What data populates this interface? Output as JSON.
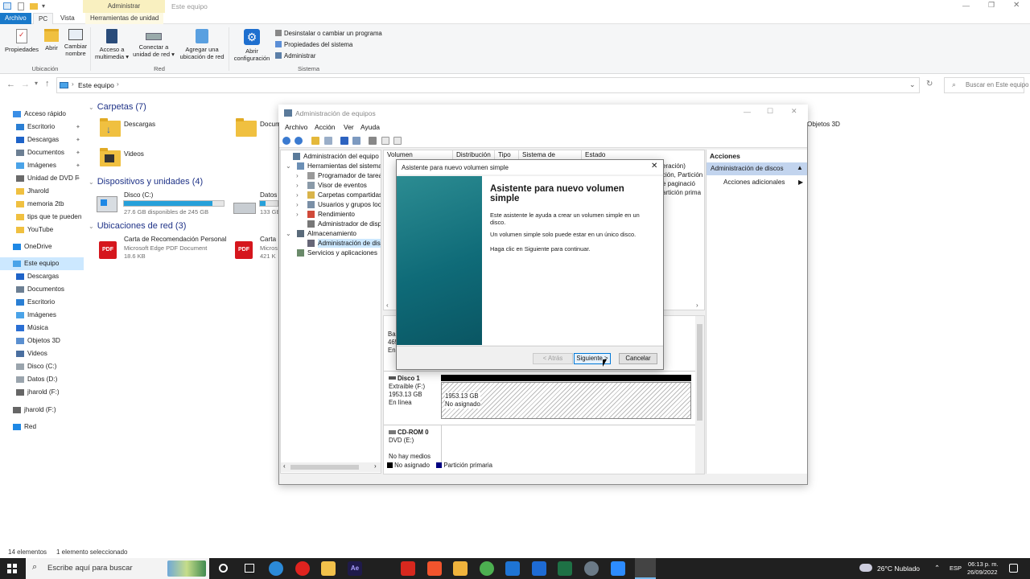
{
  "explorer": {
    "title": "Este equipo",
    "context_tab": "Administrar",
    "tabs": [
      "Archivo",
      "PC",
      "Vista",
      "Herramientas de unidad"
    ],
    "ribbon": {
      "propiedades": "Propiedades",
      "abrir": "Abrir",
      "cambiar_nombre": "Cambiar nombre",
      "acceso_multimedia": "Acceso a multimedia ▾",
      "conectar_unidad": "Conectar a unidad de red ▾",
      "agregar_ubicacion": "Agregar una ubicación de red",
      "abrir_configuracion": "Abrir configuración",
      "desinstalar": "Desinstalar o cambiar un programa",
      "propiedades_sistema": "Propiedades del sistema",
      "administrar": "Administrar",
      "group_ubicacion": "Ubicación",
      "group_red": "Red",
      "group_sistema": "Sistema"
    },
    "address": "Este equipo",
    "search_placeholder": "Buscar en Este equipo",
    "sidebar": [
      {
        "label": "Acceso rápido",
        "pin": false
      },
      {
        "label": "Escritorio",
        "pin": true
      },
      {
        "label": "Descargas",
        "pin": true
      },
      {
        "label": "Documentos",
        "pin": true
      },
      {
        "label": "Imágenes",
        "pin": true
      },
      {
        "label": "Unidad de DVD F",
        "pin": true
      },
      {
        "label": "Jharold",
        "pin": false
      },
      {
        "label": "memoria 2tb",
        "pin": false
      },
      {
        "label": "tips que te pueden s",
        "pin": false
      },
      {
        "label": "YouTube",
        "pin": false
      },
      {
        "label": "OneDrive",
        "pin": false
      },
      {
        "label": "Este equipo",
        "pin": false
      },
      {
        "label": "Descargas",
        "pin": false
      },
      {
        "label": "Documentos",
        "pin": false
      },
      {
        "label": "Escritorio",
        "pin": false
      },
      {
        "label": "Imágenes",
        "pin": false
      },
      {
        "label": "Música",
        "pin": false
      },
      {
        "label": "Objetos 3D",
        "pin": false
      },
      {
        "label": "Videos",
        "pin": false
      },
      {
        "label": "Disco (C:)",
        "pin": false
      },
      {
        "label": "Datos (D:)",
        "pin": false
      },
      {
        "label": "jharold (F:)",
        "pin": false
      },
      {
        "label": "jharold (F:)",
        "pin": false
      },
      {
        "label": "Red",
        "pin": false
      }
    ],
    "sections": {
      "carpetas": "Carpetas (7)",
      "dispositivos": "Dispositivos y unidades (4)",
      "ubicaciones_red": "Ubicaciones de red (3)"
    },
    "folders": [
      "Descargas",
      "Docum",
      "Videos",
      "Objetos 3D"
    ],
    "drives": [
      {
        "name": "Disco (C:)",
        "free": "27.6 GB disponibles de 245 GB",
        "used_fraction": 0.89
      },
      {
        "name": "Datos",
        "free": "133 GB",
        "used_fraction": 0.3
      }
    ],
    "network": [
      {
        "name": "Carta de Recomendación Personal",
        "type": "Microsoft Edge PDF Document",
        "size": "18.6 KB"
      },
      {
        "name": "Carta I",
        "type": "Micros",
        "size": "421 K"
      }
    ],
    "status_count": "14 elementos",
    "status_selected": "1 elemento seleccionado"
  },
  "cm": {
    "title": "Administración de equipos",
    "menu": [
      "Archivo",
      "Acción",
      "Ver",
      "Ayuda"
    ],
    "tree": [
      "Administración del equipo (loc",
      "Herramientas del sistema",
      "Programador de tareas",
      "Visor de eventos",
      "Carpetas compartidas",
      "Usuarios y grupos local",
      "Rendimiento",
      "Administrador de dispo",
      "Almacenamiento",
      "Administración de disco",
      "Servicios y aplicaciones"
    ],
    "columns": [
      "Volumen",
      "Distribución",
      "Tipo",
      "Sistema de archivos",
      "Estado"
    ],
    "status_fragments": [
      "eración)",
      "ción, Partición",
      "e paginació",
      "artición prima"
    ],
    "actions_title": "Acciones",
    "actions_selected": "Administración de discos",
    "actions_more": "Acciones adicionales",
    "disk_partial": [
      "Bas",
      "465",
      "En"
    ],
    "disk1": {
      "name": "Disco 1",
      "type": "Extraíble (F:)",
      "size": "1953.13 GB",
      "state": "En línea",
      "part_size": "1953.13 GB",
      "part_state": "No asignado"
    },
    "cdrom": {
      "name": "CD-ROM 0",
      "drive": "DVD (E:)",
      "state": "No hay medios"
    },
    "legend": [
      "No asignado",
      "Partición primaria"
    ]
  },
  "wizard": {
    "title": "Asistente para nuevo volumen simple",
    "heading": "Asistente para nuevo volumen simple",
    "p1": "Este asistente le ayuda a crear un volumen simple en un disco.",
    "p2": "Un volumen simple solo puede estar en un único disco.",
    "p3": "Haga clic en Siguiente para continuar.",
    "back": "< Atrás",
    "next": "Siguiente >",
    "cancel": "Cancelar"
  },
  "taskbar": {
    "search_placeholder": "Escribe aquí para buscar",
    "weather": "26°C Nublado",
    "lang": "ESP",
    "time": "06:13 p. m.",
    "date": "26/09/2022"
  },
  "colors": {
    "accent": "#26a0da",
    "wizard_teal": "#0f6b78",
    "disk_bar": "#000000",
    "primary_part": "#000080"
  }
}
